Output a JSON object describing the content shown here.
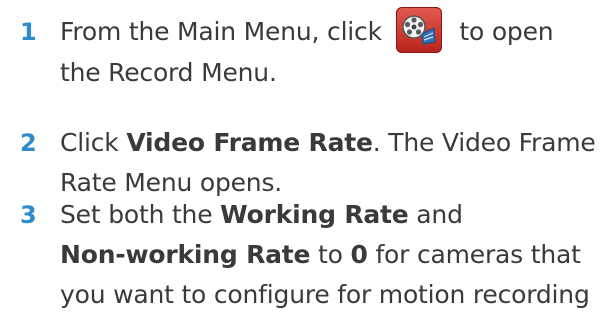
{
  "colors": {
    "step_number": "#2d8ccb",
    "body_text": "#3a3a3a",
    "icon_red": "#c9302a"
  },
  "steps": [
    {
      "number": "1",
      "line1_before": "From the Main Menu, click",
      "icon": "record-film-camera-icon",
      "line1_after": "to open",
      "line2": "the Record Menu."
    },
    {
      "number": "2",
      "line1_before": "Click ",
      "line1_bold": "Video Frame Rate",
      "line1_after": ". The Video Frame",
      "line2": "Rate Menu opens."
    },
    {
      "number": "3",
      "line1_before": "Set both the ",
      "line1_bold": "Working Rate",
      "line1_after": " and",
      "line2_bold_a": "Non-working Rate",
      "line2_mid": " to ",
      "line2_bold_b": "0",
      "line2_after": " for cameras that",
      "line3": "you want to configure for motion recording"
    }
  ]
}
